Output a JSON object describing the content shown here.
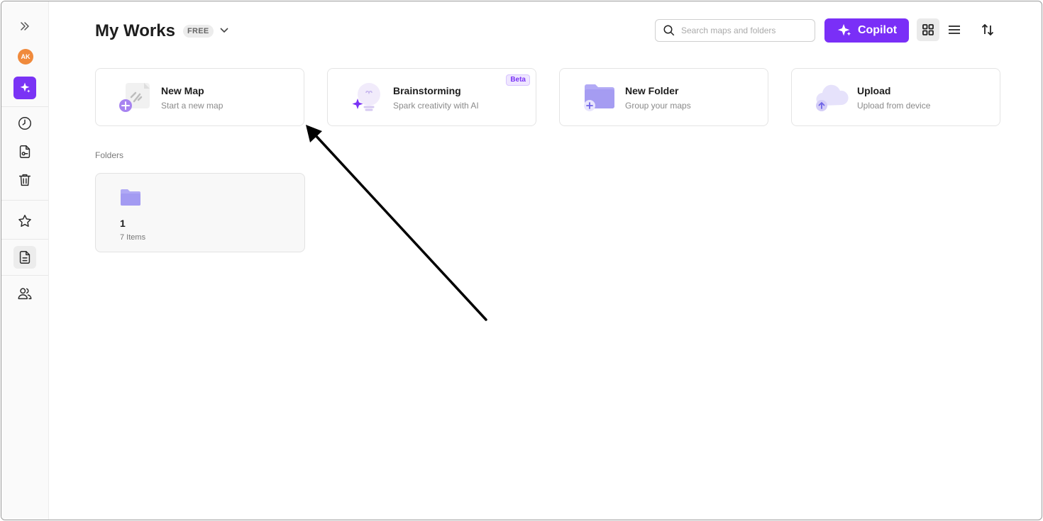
{
  "header": {
    "title": "My Works",
    "plan_badge": "FREE",
    "search_placeholder": "Search maps and folders",
    "copilot_label": "Copilot"
  },
  "sidebar": {
    "avatar_initials": "AK",
    "items": [
      {
        "icon": "expand-icon"
      },
      {
        "icon": "sparkle-icon"
      },
      {
        "icon": "clock-icon"
      },
      {
        "icon": "shared-file-icon"
      },
      {
        "icon": "trash-icon"
      },
      {
        "icon": "star-icon"
      },
      {
        "icon": "document-icon"
      },
      {
        "icon": "team-icon"
      }
    ]
  },
  "actions": [
    {
      "title": "New Map",
      "subtitle": "Start a new map"
    },
    {
      "title": "Brainstorming",
      "subtitle": "Spark creativity with AI",
      "badge": "Beta"
    },
    {
      "title": "New Folder",
      "subtitle": "Group your maps"
    },
    {
      "title": "Upload",
      "subtitle": "Upload from device"
    }
  ],
  "folders_section": {
    "label": "Folders",
    "items": [
      {
        "name": "1",
        "count": "7 Items"
      }
    ]
  },
  "colors": {
    "accent": "#7a2ff7",
    "avatar": "#f08a3c",
    "folder": "#a9a4f5"
  }
}
